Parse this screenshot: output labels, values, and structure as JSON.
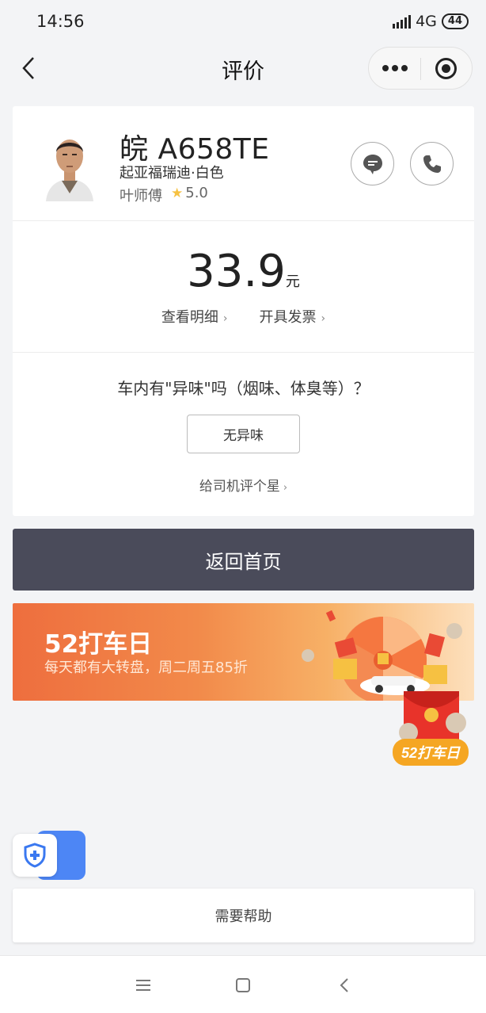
{
  "status_bar": {
    "time": "14:56",
    "network": "4G",
    "battery": "44"
  },
  "nav": {
    "title": "评价"
  },
  "driver": {
    "plate": "皖 A658TE",
    "car": "起亚福瑞迪·白色",
    "name": "叶师傅",
    "rating": "5.0"
  },
  "fare": {
    "amount": "33.9",
    "unit": "元",
    "detail_link": "查看明细",
    "invoice_link": "开具发票"
  },
  "smell": {
    "question": "车内有\"异味\"吗（烟味、体臭等）？",
    "option": "无异味",
    "rate_link": "给司机评个星"
  },
  "home_button": "返回首页",
  "banner": {
    "title": "52打车日",
    "subtitle": "每天都有大转盘，周二周五85折"
  },
  "floating_badge": "52打车日",
  "help_button": "需要帮助",
  "colors": {
    "dark_button": "#4a4b5a",
    "banner_orange": "#ee6e3e",
    "shield_blue": "#4d86f5",
    "star": "#f6c142"
  }
}
